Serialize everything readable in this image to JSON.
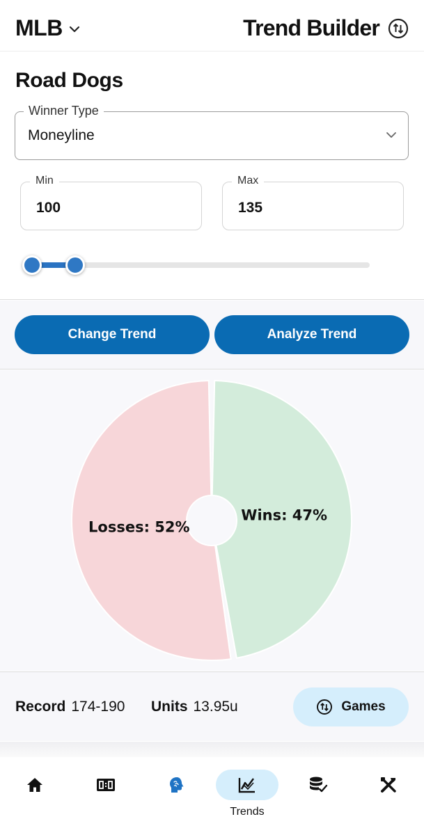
{
  "header": {
    "league": "MLB",
    "title": "Trend Builder"
  },
  "filters": {
    "trend_name": "Road Dogs",
    "winner_type_label": "Winner Type",
    "winner_type_value": "Moneyline",
    "min_label": "Min",
    "min_value": "100",
    "max_label": "Max",
    "max_value": "135",
    "slider_low_fraction": 0.02,
    "slider_high_fraction": 0.15
  },
  "actions": {
    "change_label": "Change Trend",
    "analyze_label": "Analyze Trend"
  },
  "chart_data": {
    "type": "pie",
    "categories": [
      "Wins",
      "Losses"
    ],
    "values": [
      47,
      52
    ],
    "labels": [
      "Wins: 47%",
      "Losses: 52%"
    ],
    "colors": [
      "#d3ecdb",
      "#f7d6d9"
    ]
  },
  "summary": {
    "record_label": "Record",
    "record_value": "174-190",
    "units_label": "Units",
    "units_value": "13.95u",
    "games_label": "Games"
  },
  "nav": {
    "items": [
      {
        "icon": "home-icon",
        "label": ""
      },
      {
        "icon": "scoreboard-icon",
        "label": ""
      },
      {
        "icon": "brain-icon",
        "label": ""
      },
      {
        "icon": "trend-chart-icon",
        "label": "Trends",
        "active": true
      },
      {
        "icon": "database-check-icon",
        "label": ""
      },
      {
        "icon": "tools-icon",
        "label": ""
      }
    ]
  }
}
